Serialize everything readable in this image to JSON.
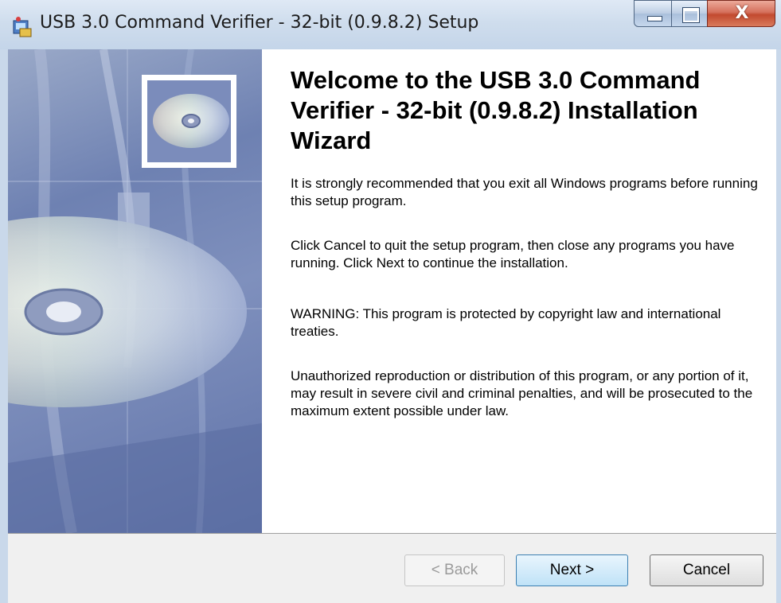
{
  "window": {
    "title": "USB 3.0 Command Verifier - 32-bit (0.9.8.2) Setup",
    "icon": "setup-installer-icon",
    "controls": {
      "minimize": "minimize-icon",
      "maximize": "maximize-icon",
      "close_glyph": "X"
    }
  },
  "wizard": {
    "heading": "Welcome to the USB 3.0 Command Verifier - 32-bit (0.9.8.2) Installation Wizard",
    "paragraphs": [
      "It is strongly recommended that you exit all Windows programs before running this setup program.",
      "Click Cancel to quit the setup program, then close any programs you have running.  Click Next to continue the installation.",
      "WARNING: This program is protected by copyright law and international treaties.",
      "Unauthorized reproduction or distribution of this program, or any portion of it, may result in severe civil and criminal penalties, and will be prosecuted to the maximum extent possible under law."
    ],
    "banner_icon": "cd-disc-icon"
  },
  "buttons": {
    "back": "< Back",
    "next": "Next >",
    "cancel": "Cancel"
  },
  "colors": {
    "title_bar": "#cfdded",
    "close_button": "#c24a2f",
    "banner_blue": "#6e81b2",
    "next_button": "#bfe2f7"
  }
}
